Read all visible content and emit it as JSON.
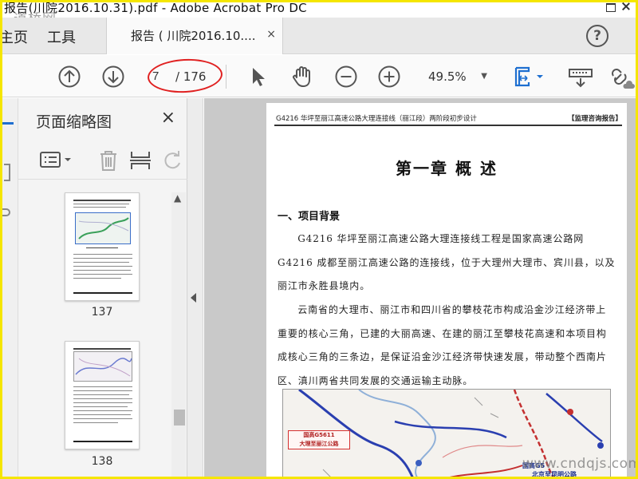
{
  "app": {
    "title_bar": "报告(川院2016.10.31).pdf - Adobe Acrobat Pro DC",
    "watermark_top": "道桥网",
    "watermark_bottom": "www.cndqjs.com"
  },
  "menu_tabs": [
    "主页",
    "工具"
  ],
  "document_tab": {
    "label": "报告 ( 川院2016.10....",
    "close": "×"
  },
  "help": "?",
  "toolbar": {
    "page_current": "7",
    "page_total": "/ 176",
    "zoom": "49.5%",
    "icons": [
      "prev-page-icon",
      "next-page-icon",
      "select-arrow-icon",
      "hand-icon",
      "zoom-out-icon",
      "zoom-in-icon",
      "fit-page-icon",
      "keyboard-icon",
      "link-share-icon"
    ]
  },
  "thumbnail_panel": {
    "title": "页面缩略图",
    "close": "×",
    "tools": [
      "options-icon",
      "delete-icon",
      "insert-page-icon",
      "rotate-icon"
    ],
    "thumbnails": [
      {
        "page": "137"
      },
      {
        "page": "138"
      }
    ]
  },
  "document": {
    "header_left": "G4216 华坪至丽江高速公路大理连接线（丽江段）两阶段初步设计",
    "header_right": "【监理咨询报告】",
    "chapter_title": "第一章   概   述",
    "section_title": "一、项目背景",
    "paragraph1": "G4216 华坪至丽江高速公路大理连接线工程是国家高速公路网 G4216 成都至丽江高速公路的连接线，位于大理州大理市、宾川县，以及丽江市永胜县境内。",
    "paragraph2": "云南省的大理市、丽江市和四川省的攀枝花市构成沿金沙江经济带上重要的核心三角，已建的大丽高速、在建的丽江至攀枝花高速和本项目构成核心三角的三条边，是保证沿金沙江经济带快速发展，带动整个西南片区、滇川两省共同发展的交通运输主动脉。",
    "map": {
      "callout_line1": "国高G5611",
      "callout_line2": "大理至丽江公路",
      "highway_label": "国高G5",
      "highway_label2": "北京至昆明公路"
    }
  },
  "colors": {
    "frame": "#f5e600",
    "annotation": "#e02020",
    "accent": "#1e6fd0"
  }
}
